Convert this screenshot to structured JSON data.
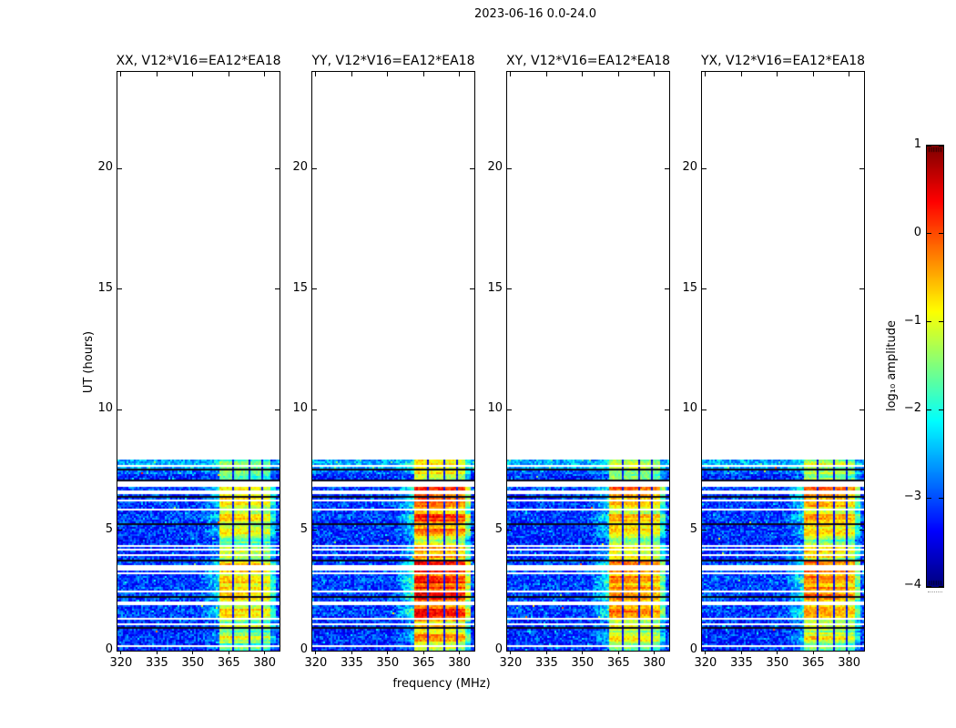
{
  "figure": {
    "title": "2023-06-16 0.0-24.0",
    "xlabel": "frequency (MHz)",
    "ylabel": "UT (hours)",
    "colorbar_label": "log₁₀ amplitude"
  },
  "chart_data": {
    "type": "heatmap",
    "title": "2023-06-16 0.0-24.0",
    "description": "Four dynamic-spectrum panels (waterfall plots) of cross-correlation amplitude vs frequency and time for one baseline, one per polarization product, with a jet colorbar of log10 amplitude.",
    "panels": [
      {
        "pol": "XX",
        "label": "XX, V12*V16=EA12*EA18",
        "band_base": -2.3,
        "band_gain": 1.75,
        "shoulder": 0.7
      },
      {
        "pol": "YY",
        "label": "YY, V12*V16=EA12*EA18",
        "band_base": -1.9,
        "band_gain": 2.3,
        "shoulder": 1.0
      },
      {
        "pol": "XY",
        "label": "XY, V12*V16=EA12*EA18",
        "band_base": -2.15,
        "band_gain": 2.0,
        "shoulder": 0.85
      },
      {
        "pol": "YX",
        "label": "YX, V12*V16=EA12*EA18",
        "band_base": -2.2,
        "band_gain": 2.0,
        "shoulder": 0.85
      }
    ],
    "x": {
      "label": "frequency (MHz)",
      "range": [
        318.5,
        386.2
      ],
      "ticks": [
        320,
        335,
        350,
        365,
        380
      ]
    },
    "y": {
      "label": "UT (hours)",
      "range": [
        0,
        24
      ],
      "ticks": [
        0,
        5,
        10,
        15,
        20
      ]
    },
    "color": {
      "label": "log₁₀ amplitude",
      "range": [
        -4,
        1
      ],
      "ticks": [
        "1",
        "0",
        "−1",
        "−2",
        "−3",
        "−4"
      ],
      "tick_values": [
        1,
        0,
        -1,
        -2,
        -3,
        -4
      ],
      "colormap": "jet",
      "legend_position": "right"
    },
    "data_extent_hours": [
      0,
      7.92
    ],
    "background_level_log10": -3.4,
    "band_segments": [
      {
        "f0": 361.2,
        "f1": 366.6,
        "offset": 0.0,
        "gap": false
      },
      {
        "f0": 366.6,
        "f1": 367.3,
        "offset": 0.0,
        "gap": true
      },
      {
        "f0": 367.3,
        "f1": 373.1,
        "offset": -0.08,
        "gap": false
      },
      {
        "f0": 373.1,
        "f1": 373.8,
        "offset": 0.0,
        "gap": true
      },
      {
        "f0": 373.8,
        "f1": 378.6,
        "offset": -0.15,
        "gap": false
      },
      {
        "f0": 378.6,
        "f1": 379.3,
        "offset": 0.0,
        "gap": true
      },
      {
        "f0": 379.3,
        "f1": 382.5,
        "offset": -0.28,
        "gap": false
      },
      {
        "f0": 382.5,
        "f1": 384.3,
        "offset": -1.3,
        "gap": false
      }
    ],
    "white_gap_times": [
      0.19,
      1.13,
      1.32,
      1.96,
      2.45,
      3.21,
      3.32,
      3.47,
      3.96,
      4.19,
      4.34,
      5.85,
      6.2,
      6.49,
      6.6,
      6.79,
      6.9,
      7.62
    ],
    "thick_gap_times": [
      1.96,
      3.32,
      6.9
    ],
    "black_row_times": [
      0.92,
      1.06,
      2.26,
      3.77,
      5.24,
      6.36,
      7.08,
      7.47
    ],
    "grid": false,
    "noise_seed": 11
  }
}
